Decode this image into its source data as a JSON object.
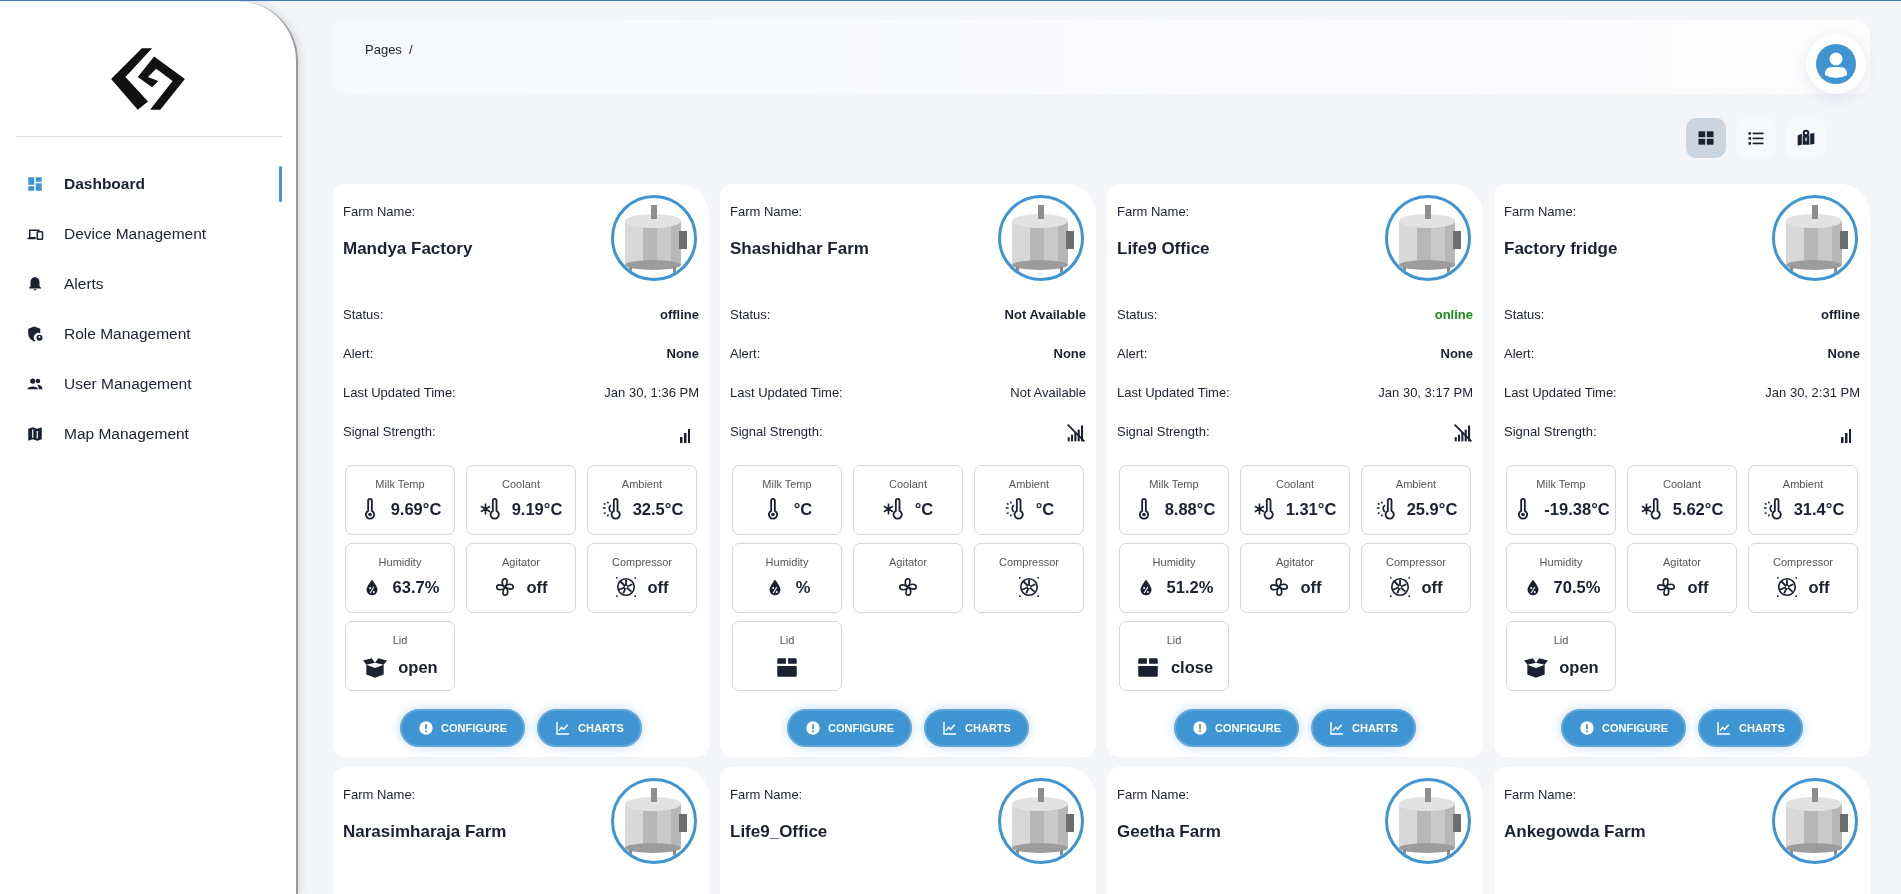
{
  "sidebar": {
    "items": [
      {
        "label": "Dashboard",
        "kind": "dashboard",
        "selected": true
      },
      {
        "label": "Device Management",
        "kind": "devices",
        "selected": false
      },
      {
        "label": "Alerts",
        "kind": "bell",
        "selected": false
      },
      {
        "label": "Role Management",
        "kind": "shield",
        "selected": false
      },
      {
        "label": "User Management",
        "kind": "users",
        "selected": false
      },
      {
        "label": "Map Management",
        "kind": "map",
        "selected": false
      }
    ]
  },
  "breadcrumb": "Pages  /",
  "view_modes": [
    {
      "kind": "grid",
      "selected": true
    },
    {
      "kind": "list",
      "selected": false
    },
    {
      "kind": "map",
      "selected": false
    }
  ],
  "cards": [
    {
      "farm_name_label": "Farm Name:",
      "farm_name": "Mandya Factory",
      "image": {
        "kind": "picture"
      },
      "details": [
        {
          "kind": "status",
          "label": "Status:",
          "value": "offline",
          "online": false
        },
        {
          "kind": "bold",
          "label": "Alert:",
          "value": "None"
        },
        {
          "kind": "plain",
          "label": "Last Updated Time:",
          "value": "Jan 30, 1:36 PM"
        },
        {
          "kind": "signal",
          "label": "Signal Strength:",
          "connected": true
        }
      ],
      "sensors": [
        {
          "kind": "milk",
          "label": "Milk Temp",
          "value": "9.69°C"
        },
        {
          "kind": "coolant",
          "label": "Coolant",
          "value": "9.19°C"
        },
        {
          "kind": "ambient",
          "label": "Ambient",
          "value": "32.5°C"
        },
        {
          "kind": "humidity",
          "label": "Humidity",
          "value": "63.7%"
        },
        {
          "kind": "agitator",
          "label": "Agitator",
          "value": "off"
        },
        {
          "kind": "compressor",
          "label": "Compressor",
          "value": "off"
        },
        {
          "kind": "lid",
          "label": "Lid",
          "value": "open",
          "open": true
        }
      ],
      "buttons": [
        {
          "kind": "configure",
          "label": "CONFIGURE"
        },
        {
          "kind": "charts",
          "label": "CHARTS"
        }
      ]
    },
    {
      "farm_name_label": "Farm Name:",
      "farm_name": "Shashidhar Farm",
      "image": {
        "kind": "picture"
      },
      "details": [
        {
          "kind": "status",
          "label": "Status:",
          "value": "Not Available",
          "online": false
        },
        {
          "kind": "bold",
          "label": "Alert:",
          "value": "None"
        },
        {
          "kind": "plain",
          "label": "Last Updated Time:",
          "value": "Not Available"
        },
        {
          "kind": "signal",
          "label": "Signal Strength:",
          "connected": false
        }
      ],
      "sensors": [
        {
          "kind": "milk",
          "label": "Milk Temp",
          "value": "°C"
        },
        {
          "kind": "coolant",
          "label": "Coolant",
          "value": "°C"
        },
        {
          "kind": "ambient",
          "label": "Ambient",
          "value": "°C"
        },
        {
          "kind": "humidity",
          "label": "Humidity",
          "value": "%"
        },
        {
          "kind": "agitator",
          "label": "Agitator"
        },
        {
          "kind": "compressor",
          "label": "Compressor"
        },
        {
          "kind": "lid",
          "label": "Lid",
          "open": false
        }
      ],
      "buttons": [
        {
          "kind": "configure",
          "label": "CONFIGURE"
        },
        {
          "kind": "charts",
          "label": "CHARTS"
        }
      ]
    },
    {
      "farm_name_label": "Farm Name:",
      "farm_name": "Life9 Office",
      "image": {
        "kind": "picture"
      },
      "details": [
        {
          "kind": "status",
          "label": "Status:",
          "value": "online",
          "online": true
        },
        {
          "kind": "bold",
          "label": "Alert:",
          "value": "None"
        },
        {
          "kind": "plain",
          "label": "Last Updated Time:",
          "value": "Jan 30, 3:17 PM"
        },
        {
          "kind": "signal",
          "label": "Signal Strength:",
          "connected": false
        }
      ],
      "sensors": [
        {
          "kind": "milk",
          "label": "Milk Temp",
          "value": "8.88°C"
        },
        {
          "kind": "coolant",
          "label": "Coolant",
          "value": "1.31°C"
        },
        {
          "kind": "ambient",
          "label": "Ambient",
          "value": "25.9°C"
        },
        {
          "kind": "humidity",
          "label": "Humidity",
          "value": "51.2%"
        },
        {
          "kind": "agitator",
          "label": "Agitator",
          "value": "off"
        },
        {
          "kind": "compressor",
          "label": "Compressor",
          "value": "off"
        },
        {
          "kind": "lid",
          "label": "Lid",
          "value": "close",
          "open": false
        }
      ],
      "buttons": [
        {
          "kind": "configure",
          "label": "CONFIGURE"
        },
        {
          "kind": "charts",
          "label": "CHARTS"
        }
      ]
    },
    {
      "farm_name_label": "Farm Name:",
      "farm_name": "Factory fridge",
      "image": {
        "kind": "picture"
      },
      "details": [
        {
          "kind": "status",
          "label": "Status:",
          "value": "offline",
          "online": false
        },
        {
          "kind": "bold",
          "label": "Alert:",
          "value": "None"
        },
        {
          "kind": "plain",
          "label": "Last Updated Time:",
          "value": "Jan 30, 2:31 PM"
        },
        {
          "kind": "signal",
          "label": "Signal Strength:",
          "connected": true
        }
      ],
      "sensors": [
        {
          "kind": "milk",
          "label": "Milk Temp",
          "value": "-19.38°C"
        },
        {
          "kind": "coolant",
          "label": "Coolant",
          "value": "5.62°C"
        },
        {
          "kind": "ambient",
          "label": "Ambient",
          "value": "31.4°C"
        },
        {
          "kind": "humidity",
          "label": "Humidity",
          "value": "70.5%"
        },
        {
          "kind": "agitator",
          "label": "Agitator",
          "value": "off"
        },
        {
          "kind": "compressor",
          "label": "Compressor",
          "value": "off"
        },
        {
          "kind": "lid",
          "label": "Lid",
          "value": "open",
          "open": true
        }
      ],
      "buttons": [
        {
          "kind": "configure",
          "label": "CONFIGURE"
        },
        {
          "kind": "charts",
          "label": "CHARTS"
        }
      ]
    },
    {
      "farm_name_label": "Farm Name:",
      "farm_name": "Narasimharaja Farm",
      "image": {
        "kind": "picture"
      }
    },
    {
      "farm_name_label": "Farm Name:",
      "farm_name": "Life9_Office",
      "image": {
        "kind": "picture"
      }
    },
    {
      "farm_name_label": "Farm Name:",
      "farm_name": "Geetha Farm",
      "image": {
        "kind": "picture"
      }
    },
    {
      "farm_name_label": "Farm Name:",
      "farm_name": "Ankegowda Farm",
      "image": {
        "kind": "picture"
      }
    }
  ]
}
